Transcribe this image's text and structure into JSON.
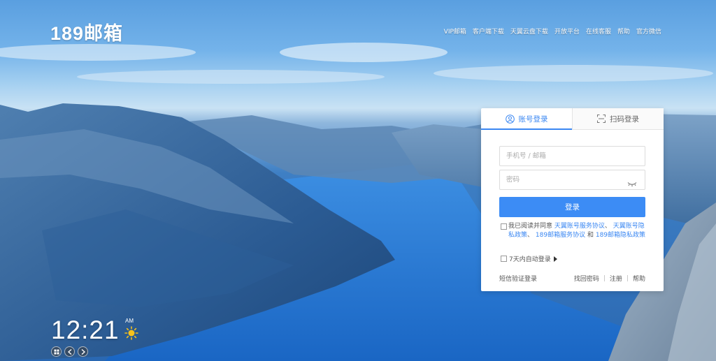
{
  "brand": {
    "logo_text": "189邮箱"
  },
  "topnav": [
    {
      "label": "VIP邮箱"
    },
    {
      "label": "客户端下载"
    },
    {
      "label": "天翼云盘下载"
    },
    {
      "label": "开放平台"
    },
    {
      "label": "在线客服"
    },
    {
      "label": "帮助"
    },
    {
      "label": "官方微信"
    }
  ],
  "login": {
    "tabs": [
      {
        "label": "账号登录",
        "icon": "user-icon",
        "active": true
      },
      {
        "label": "扫码登录",
        "icon": "qr-scan-icon",
        "active": false
      }
    ],
    "username_placeholder": "手机号 / 邮箱",
    "password_placeholder": "密码",
    "submit_label": "登录",
    "agreement": {
      "prefix": "我已阅读并同意",
      "link1": "天翼账号服务协议",
      "sep1": "、",
      "link2": "天翼账号隐私政策",
      "sep2": "、",
      "link3": "189邮箱服务协议",
      "and": "和",
      "link4": "189邮箱隐私政策"
    },
    "auto_login_label": "7天内自动登录",
    "sms_login": "短信验证登录",
    "find_password": "找回密码",
    "register": "注册",
    "help": "帮助",
    "separator": "|"
  },
  "clock": {
    "time": "12:21",
    "ampm": "AM",
    "weather_icon": "sun-icon"
  },
  "colors": {
    "accent": "#3c8cf5",
    "link": "#3a87f2"
  }
}
